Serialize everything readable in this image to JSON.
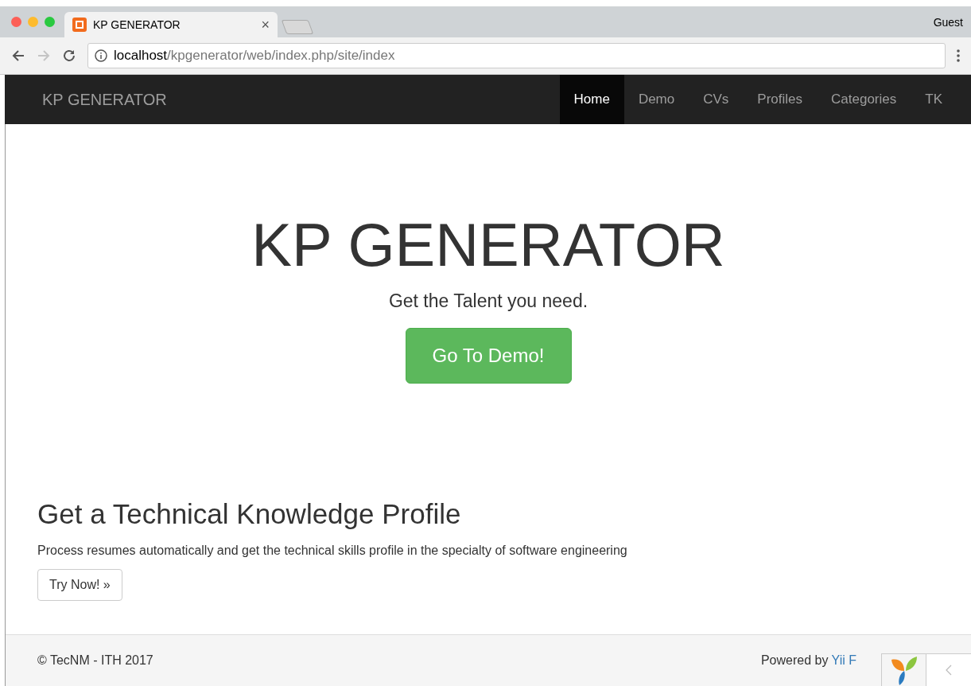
{
  "browser": {
    "tab": {
      "title": "KP GENERATOR",
      "close": "×"
    },
    "profile": "Guest",
    "address": {
      "host": "localhost",
      "path": "/kpgenerator/web/index.php/site/index"
    }
  },
  "navbar": {
    "brand": "KP GENERATOR",
    "items": [
      {
        "label": "Home",
        "selected": true
      },
      {
        "label": "Demo",
        "selected": false
      },
      {
        "label": "CVs",
        "selected": false
      },
      {
        "label": "Profiles",
        "selected": false
      },
      {
        "label": "Categories",
        "selected": false
      },
      {
        "label": "TK",
        "selected": false
      }
    ]
  },
  "hero": {
    "title": "KP GENERATOR",
    "lead": "Get the Talent you need.",
    "button": "Go To Demo!"
  },
  "section": {
    "heading": "Get a Technical Knowledge Profile",
    "text": "Process resumes automatically and get the technical skills profile in the specialty of software engineering",
    "button": "Try Now! »"
  },
  "footer": {
    "copyright": "© TecNM - ITH 2017",
    "powered": "Powered by",
    "link": "Yii F"
  }
}
